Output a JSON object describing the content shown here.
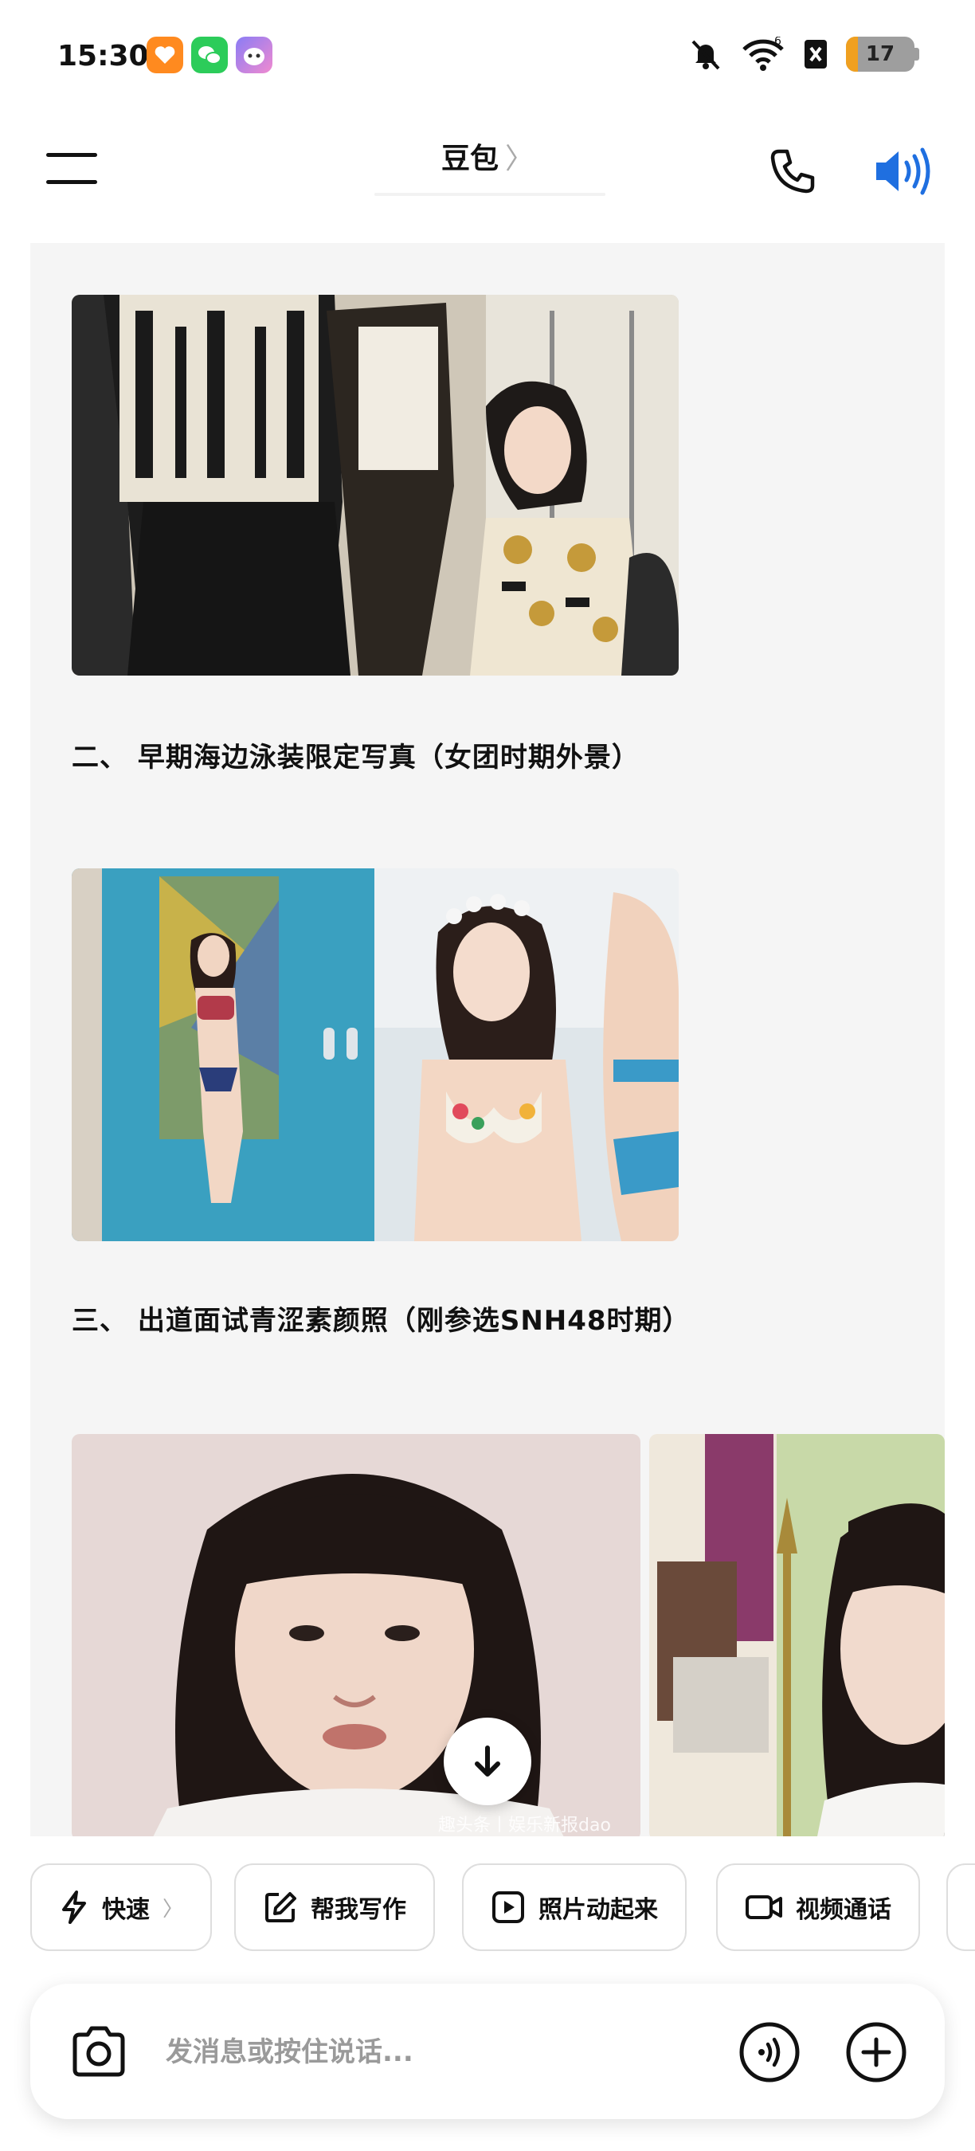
{
  "status_bar": {
    "time": "15:30",
    "battery_level": "17",
    "battery_fraction": 0.17,
    "app_icons": [
      "health-app-icon",
      "wechat-icon",
      "doubao-app-icon"
    ]
  },
  "header": {
    "title": "豆包",
    "title_chevron": "〉"
  },
  "chat": {
    "heading_2": "二、 早期海边泳装限定写真（女团时期外景）",
    "heading_3": "三、 出道面试青涩素颜照（刚参选SNH48时期）",
    "photo_watermark": "趣头条丨娱乐新报dao"
  },
  "quick_actions": [
    {
      "label": "快速",
      "chevron": "〉",
      "icon": "lightning-icon"
    },
    {
      "label": "帮我写作",
      "icon": "edit-icon"
    },
    {
      "label": "照片动起来",
      "icon": "play-icon"
    },
    {
      "label": "视频通话",
      "icon": "video-camera-icon"
    }
  ],
  "composer": {
    "placeholder": "发消息或按住说话..."
  },
  "colors": {
    "accent": "#1f6fe0",
    "chat_bg": "#f5f5f5"
  }
}
